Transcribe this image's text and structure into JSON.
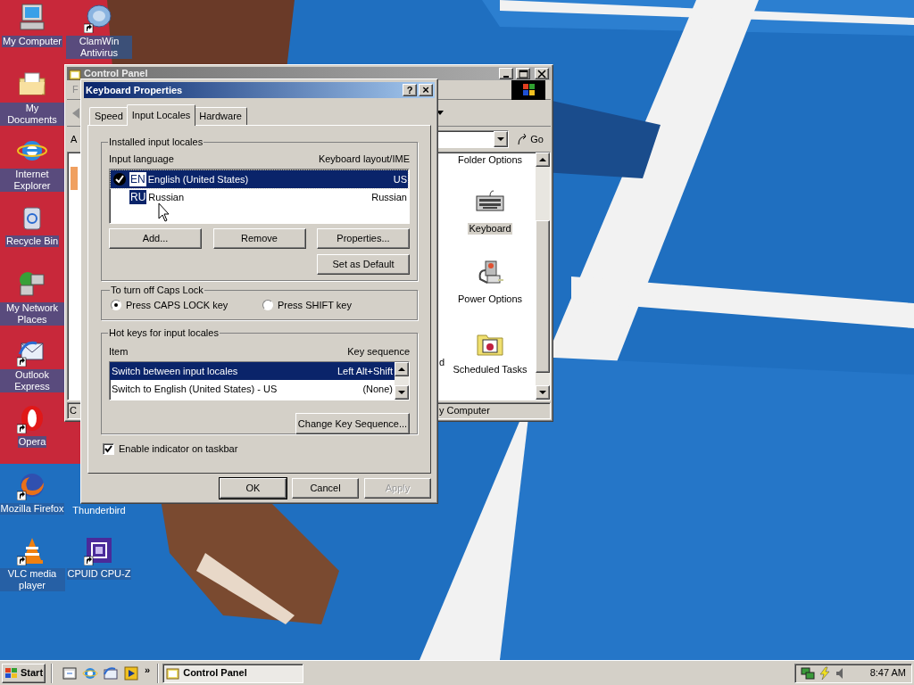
{
  "desktop_icons": [
    {
      "label": "My Computer",
      "kind": "computer",
      "shortcut": false
    },
    {
      "label": "ClamWin Antivirus",
      "kind": "clamwin",
      "shortcut": true
    },
    {
      "label": "My Documents",
      "kind": "documents",
      "shortcut": false
    },
    {
      "label": "Internet Explorer",
      "kind": "ie",
      "shortcut": false
    },
    {
      "label": "Recycle Bin",
      "kind": "recycle",
      "shortcut": false
    },
    {
      "label": "My Network Places",
      "kind": "network",
      "shortcut": false
    },
    {
      "label": "Outlook Express",
      "kind": "outlook",
      "shortcut": true
    },
    {
      "label": "Opera",
      "kind": "opera",
      "shortcut": true
    },
    {
      "label": "Mozilla Firefox",
      "kind": "firefox",
      "shortcut": true
    },
    {
      "label": "Thunderbird",
      "kind": "hidden"
    },
    {
      "label": "VLC media player",
      "kind": "vlc",
      "shortcut": true
    },
    {
      "label": "CPUID CPU-Z",
      "kind": "cpuz",
      "shortcut": true
    }
  ],
  "control_panel": {
    "title": "Control Panel",
    "menu_letter": "F",
    "address_label": "A",
    "go": "Go",
    "status_left": "C",
    "status_right": "y Computer",
    "partial_label": "d",
    "items": [
      {
        "label": "Folder Options",
        "kind": "hidden",
        "selected": false
      },
      {
        "label": "Keyboard",
        "kind": "keyboard",
        "selected": true
      },
      {
        "label": "Power Options",
        "kind": "power",
        "selected": false
      },
      {
        "label": "Scheduled Tasks",
        "kind": "tasks",
        "selected": false
      }
    ]
  },
  "dialog": {
    "title": "Keyboard Properties",
    "help": "?",
    "close": "×",
    "tabs": [
      {
        "label": "Speed",
        "selected": false
      },
      {
        "label": "Input Locales",
        "selected": true
      },
      {
        "label": "Hardware",
        "selected": false
      }
    ],
    "locales_group": {
      "title": "Installed input locales",
      "col_1": "Input language",
      "col_2": "Keyboard layout/IME",
      "rows": [
        {
          "code": "EN",
          "language": "English (United States)",
          "layout": "US",
          "checked": true,
          "selected": true
        },
        {
          "code": "RU",
          "language": "Russian",
          "layout": "Russian",
          "checked": false,
          "selected": false
        }
      ],
      "buttons": [
        "Add...",
        "Remove",
        "Properties..."
      ],
      "default_button": "Set as Default"
    },
    "caps_group": {
      "title": "To turn off Caps Lock",
      "options": [
        {
          "label": "Press CAPS LOCK key",
          "selected": true
        },
        {
          "label": "Press SHIFT key",
          "selected": false
        }
      ]
    },
    "hotkeys_group": {
      "title": "Hot keys for input locales",
      "col_1": "Item",
      "col_2": "Key sequence",
      "rows": [
        {
          "item": "Switch between input locales",
          "keys": "Left Alt+Shift",
          "selected": true
        },
        {
          "item": "Switch to English (United States) - US",
          "keys": "(None)",
          "selected": false
        }
      ],
      "button": "Change Key Sequence..."
    },
    "indicator": {
      "label": "Enable indicator on taskbar",
      "checked": true
    },
    "buttons": [
      {
        "label": "OK",
        "disabled": false,
        "default": true
      },
      {
        "label": "Cancel",
        "disabled": false,
        "default": false
      },
      {
        "label": "Apply",
        "disabled": true,
        "default": false
      }
    ]
  },
  "taskbar": {
    "start": "Start",
    "more": "»",
    "quick_launch": [
      {
        "kind": "desktop"
      },
      {
        "kind": "ie"
      },
      {
        "kind": "outlook"
      },
      {
        "kind": "media"
      }
    ],
    "tasks": [
      {
        "label": "Control Panel",
        "selected": true
      }
    ],
    "clock": "8:47 AM"
  }
}
